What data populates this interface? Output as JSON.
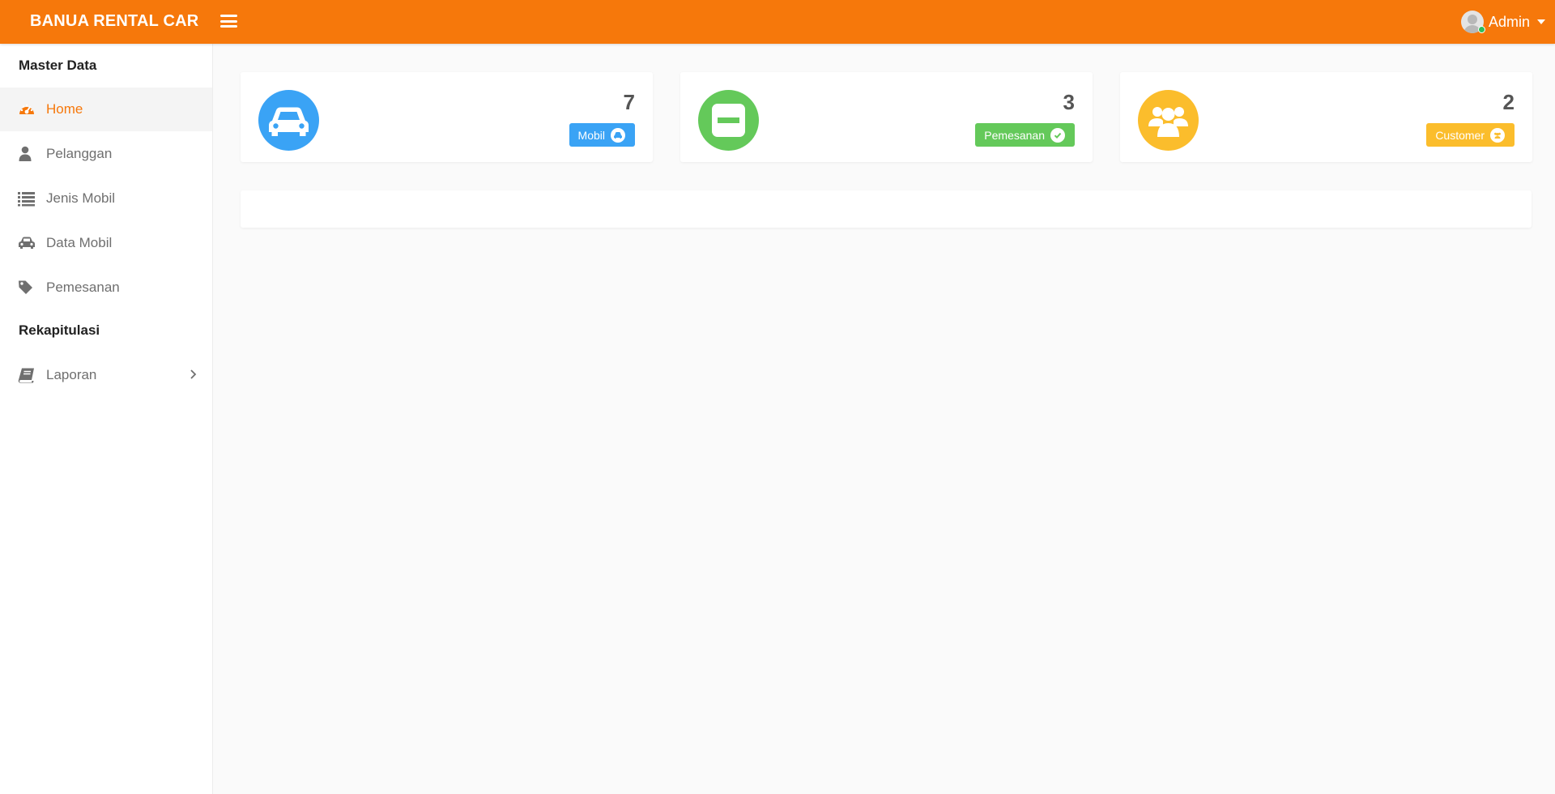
{
  "header": {
    "brand": "BANUA RENTAL CAR",
    "user_name": "Admin",
    "accent_color": "#f6780b"
  },
  "sidebar": {
    "sections": [
      {
        "title": "Master Data"
      },
      {
        "title": "Rekapitulasi"
      }
    ],
    "items": [
      {
        "label": "Home",
        "icon": "dashboard-icon",
        "active": true
      },
      {
        "label": "Pelanggan",
        "icon": "user-icon"
      },
      {
        "label": "Jenis Mobil",
        "icon": "list-icon"
      },
      {
        "label": "Data Mobil",
        "icon": "car-icon"
      },
      {
        "label": "Pemesanan",
        "icon": "tag-icon"
      },
      {
        "label": "Laporan",
        "icon": "book-icon",
        "has_submenu": true
      }
    ]
  },
  "cards": [
    {
      "count": "7",
      "badge_label": "Mobil",
      "color": "#3aa3f5",
      "icon": "car-icon",
      "badge_icon": "car-icon"
    },
    {
      "count": "3",
      "badge_label": "Pemesanan",
      "color": "#64c95a",
      "icon": "minus-square-icon",
      "badge_icon": "check-icon"
    },
    {
      "count": "2",
      "badge_label": "Customer",
      "color": "#fbbd2c",
      "icon": "users-icon",
      "badge_icon": "users-icon"
    }
  ]
}
